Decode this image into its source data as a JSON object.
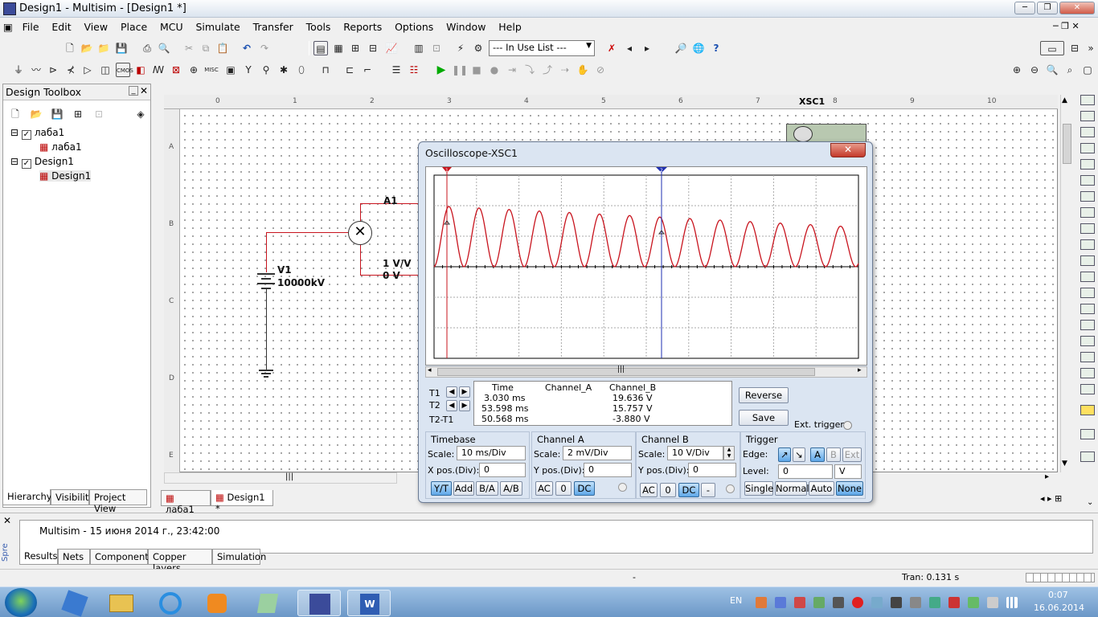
{
  "window": {
    "title": "Design1 - Multisim - [Design1 *]"
  },
  "menu": [
    "File",
    "Edit",
    "View",
    "Place",
    "MCU",
    "Simulate",
    "Transfer",
    "Tools",
    "Reports",
    "Options",
    "Window",
    "Help"
  ],
  "toolbar": {
    "in_use_list": "--- In Use List ---"
  },
  "design_toolbox": {
    "title": "Design Toolbox",
    "tree": [
      {
        "label": "лаба1",
        "level": 0,
        "checked": true
      },
      {
        "label": "лаба1",
        "level": 1
      },
      {
        "label": "Design1",
        "level": 0,
        "checked": true
      },
      {
        "label": "Design1",
        "level": 1
      }
    ],
    "tabs": [
      "Hierarchy",
      "Visibility",
      "Project View"
    ]
  },
  "schematic": {
    "instrument_label": "XSC1",
    "ammeter_label": "A1",
    "meter_reading_1": "1 V/V",
    "meter_reading_2": "0 V",
    "source_name": "V1",
    "source_value": "10000kV",
    "ruler_top": [
      "0",
      "1",
      "2",
      "3",
      "4",
      "5",
      "6",
      "7",
      "8",
      "9",
      "10"
    ],
    "ruler_left": [
      "A",
      "B",
      "C",
      "D",
      "E"
    ]
  },
  "doc_tabs": [
    "лаба1",
    "Design1 *"
  ],
  "oscilloscope": {
    "title": "Oscilloscope-XSC1",
    "cursor_t1": "1",
    "cursor_t2": "2",
    "measurements": {
      "headers": [
        "Time",
        "Channel_A",
        "Channel_B"
      ],
      "rows": [
        {
          "label": "T1",
          "time": "3.030 ms",
          "a": "",
          "b": "19.636 V"
        },
        {
          "label": "T2",
          "time": "53.598 ms",
          "a": "",
          "b": "15.757 V"
        },
        {
          "label": "T2-T1",
          "time": "50.568 ms",
          "a": "",
          "b": "-3.880 V"
        }
      ]
    },
    "reverse_button": "Reverse",
    "save_button": "Save",
    "ext_trigger": "Ext. trigger",
    "timebase": {
      "title": "Timebase",
      "scale_label": "Scale:",
      "scale": "10 ms/Div",
      "xpos_label": "X pos.(Div):",
      "xpos": "0",
      "buttons": [
        "Y/T",
        "Add",
        "B/A",
        "A/B"
      ]
    },
    "channel_a": {
      "title": "Channel A",
      "scale_label": "Scale:",
      "scale": "2 mV/Div",
      "ypos_label": "Y pos.(Div):",
      "ypos": "0",
      "buttons": [
        "AC",
        "0",
        "DC"
      ]
    },
    "channel_b": {
      "title": "Channel B",
      "scale_label": "Scale:",
      "scale": "10  V/Div",
      "ypos_label": "Y pos.(Div):",
      "ypos": "0",
      "buttons": [
        "AC",
        "0",
        "DC",
        "-"
      ]
    },
    "trigger": {
      "title": "Trigger",
      "edge_label": "Edge:",
      "edge_buttons": [
        "A",
        "B",
        "Ext"
      ],
      "level_label": "Level:",
      "level": "0",
      "level_unit": "V",
      "mode_buttons": [
        "Single",
        "Normal",
        "Auto",
        "None"
      ]
    },
    "trace_color": "#c8141e",
    "cursor1_color": "#c8141e",
    "cursor2_color": "#1f2fb0"
  },
  "spreadsheet": {
    "side_label": "Spre",
    "message": "Multisim  -  15 июня 2014 г., 23:42:00",
    "tabs": [
      "Results",
      "Nets",
      "Components",
      "Copper layers",
      "Simulation"
    ]
  },
  "statusbar": {
    "middle": "-",
    "tran": "Tran: 0.131 s"
  },
  "taskbar": {
    "lang": "EN",
    "time": "0:07",
    "date": "16.06.2014"
  }
}
